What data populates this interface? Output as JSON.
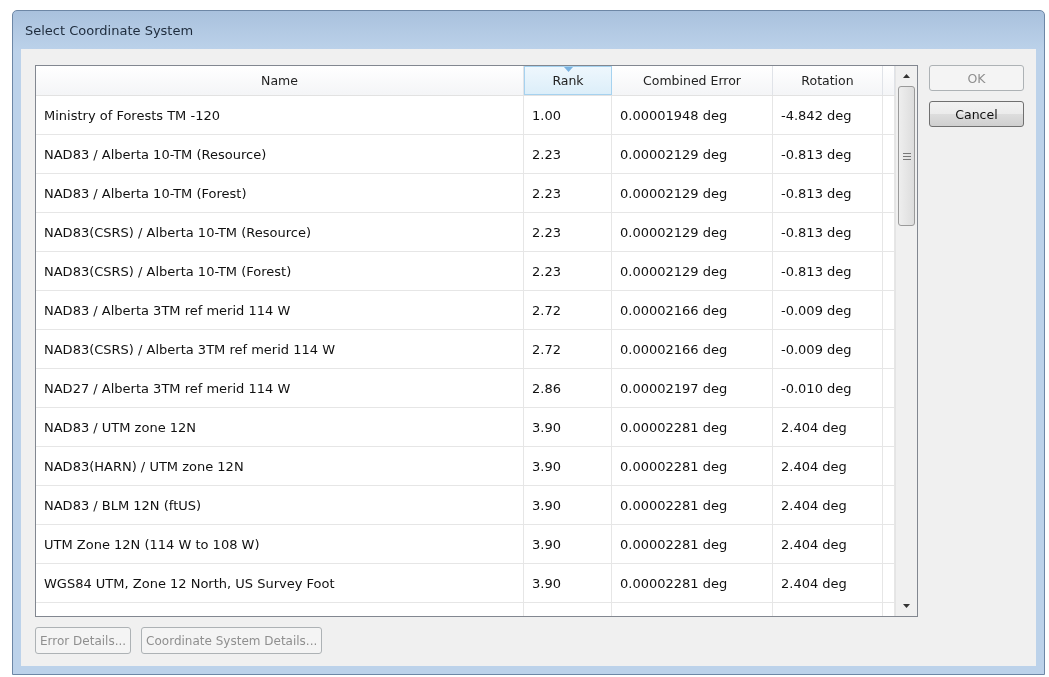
{
  "window": {
    "title": "Select Coordinate System"
  },
  "table": {
    "columns": [
      {
        "label": "Name",
        "sorted": false
      },
      {
        "label": "Rank",
        "sorted": true
      },
      {
        "label": "Combined Error",
        "sorted": false
      },
      {
        "label": "Rotation",
        "sorted": false
      }
    ],
    "rows": [
      [
        "Ministry of Forests TM -120",
        "1.00",
        "0.00001948 deg",
        "-4.842 deg"
      ],
      [
        "NAD83 / Alberta 10-TM (Resource)",
        "2.23",
        "0.00002129 deg",
        "-0.813 deg"
      ],
      [
        "NAD83 / Alberta 10-TM (Forest)",
        "2.23",
        "0.00002129 deg",
        "-0.813 deg"
      ],
      [
        "NAD83(CSRS) / Alberta 10-TM (Resource)",
        "2.23",
        "0.00002129 deg",
        "-0.813 deg"
      ],
      [
        "NAD83(CSRS) / Alberta 10-TM (Forest)",
        "2.23",
        "0.00002129 deg",
        "-0.813 deg"
      ],
      [
        "NAD83 / Alberta 3TM ref merid 114 W",
        "2.72",
        "0.00002166 deg",
        "-0.009 deg"
      ],
      [
        "NAD83(CSRS) / Alberta 3TM ref merid 114 W",
        "2.72",
        "0.00002166 deg",
        "-0.009 deg"
      ],
      [
        "NAD27 / Alberta 3TM ref merid 114 W",
        "2.86",
        "0.00002197 deg",
        "-0.010 deg"
      ],
      [
        "NAD83 / UTM zone 12N",
        "3.90",
        "0.00002281 deg",
        "2.404 deg"
      ],
      [
        "NAD83(HARN) / UTM zone 12N",
        "3.90",
        "0.00002281 deg",
        "2.404 deg"
      ],
      [
        "NAD83 / BLM 12N (ftUS)",
        "3.90",
        "0.00002281 deg",
        "2.404 deg"
      ],
      [
        "UTM Zone 12N (114 W to 108 W)",
        "3.90",
        "0.00002281 deg",
        "2.404 deg"
      ],
      [
        "WGS84 UTM, Zone 12 North, US Survey Foot",
        "3.90",
        "0.00002281 deg",
        "2.404 deg"
      ]
    ]
  },
  "side_buttons": [
    {
      "label": "OK",
      "disabled": true
    },
    {
      "label": "Cancel",
      "disabled": false
    }
  ],
  "bottom_buttons": [
    {
      "label": "Error Details...",
      "disabled": true
    },
    {
      "label": "Coordinate System Details...",
      "disabled": true
    }
  ]
}
